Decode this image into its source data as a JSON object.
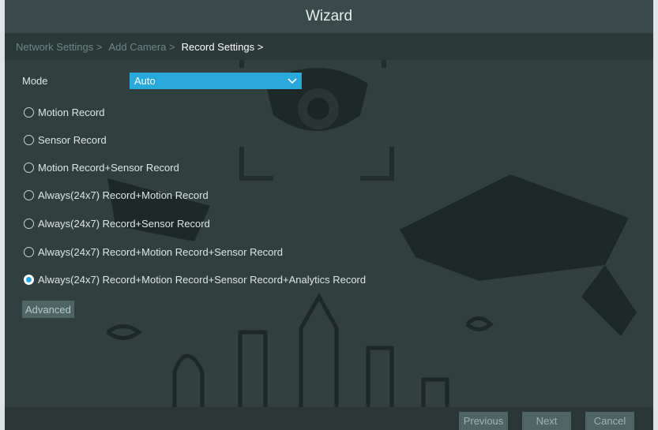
{
  "window": {
    "title": "Wizard"
  },
  "breadcrumb": [
    {
      "label": "Network Settings >",
      "state": "dim"
    },
    {
      "label": "Add Camera >",
      "state": "dim"
    },
    {
      "label": "Record Settings >",
      "state": "active"
    }
  ],
  "mode": {
    "label": "Mode",
    "value": "Auto"
  },
  "options": [
    {
      "label": "Motion Record",
      "selected": false
    },
    {
      "label": "Sensor Record",
      "selected": false
    },
    {
      "label": "Motion Record+Sensor Record",
      "selected": false
    },
    {
      "label": "Always(24x7) Record+Motion Record",
      "selected": false
    },
    {
      "label": "Always(24x7) Record+Sensor Record",
      "selected": false
    },
    {
      "label": "Always(24x7) Record+Motion Record+Sensor Record",
      "selected": false
    },
    {
      "label": "Always(24x7) Record+Motion Record+Sensor Record+Analytics Record",
      "selected": true
    }
  ],
  "advanced_label": "Advanced",
  "footer": {
    "previous": "Previous",
    "next": "Next",
    "cancel": "Cancel"
  },
  "colors": {
    "accent": "#29a8dc",
    "panel": "#31403f",
    "titlebar": "#3a4a4a"
  }
}
